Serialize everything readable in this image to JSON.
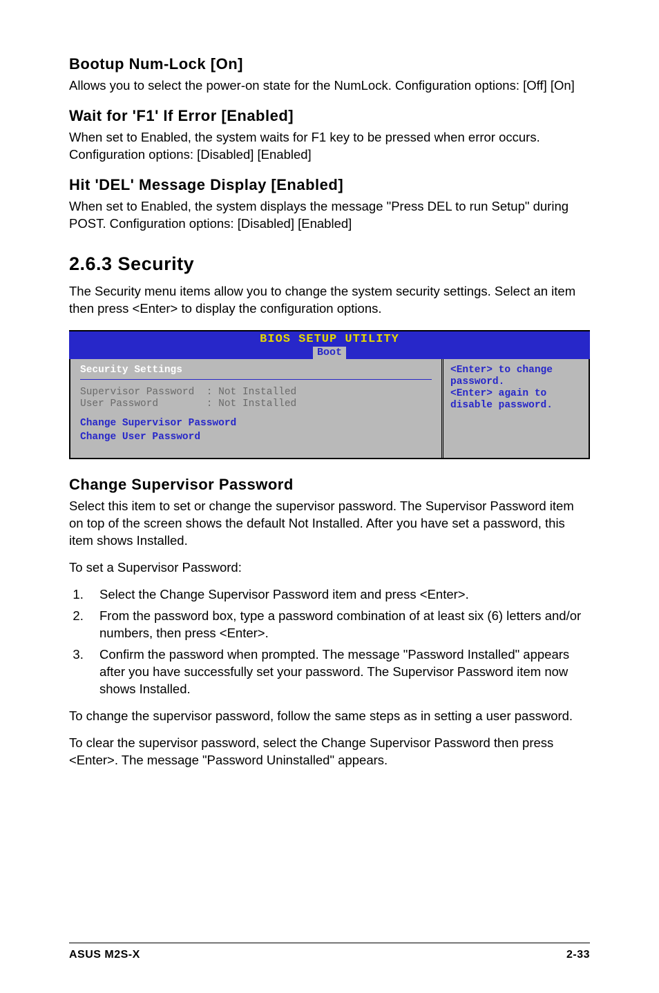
{
  "s1": {
    "h": "Bootup Num-Lock [On]",
    "p": "Allows you to select the power-on state for the NumLock. Configuration options: [Off] [On]"
  },
  "s2": {
    "h": "Wait for 'F1' If Error [Enabled]",
    "p": "When set to Enabled, the system waits for F1 key to be pressed when error occurs. Configuration options: [Disabled] [Enabled]"
  },
  "s3": {
    "h": "Hit 'DEL' Message Display [Enabled]",
    "p": "When set to Enabled, the system displays the message \"Press DEL to run Setup\" during POST. Configuration options: [Disabled] [Enabled]"
  },
  "sec": {
    "h": "2.6.3   Security",
    "p": "The Security menu items allow you to change the system security settings. Select an item then press <Enter> to display the configuration options."
  },
  "bios": {
    "title": "BIOS SETUP UTILITY",
    "tab": "Boot",
    "left_title": "Security Settings",
    "line1": "Supervisor Password  : Not Installed",
    "line2": "User Password        : Not Installed",
    "line3": "Change Supervisor Password",
    "line4": "Change User Password",
    "r1": "<Enter> to change",
    "r2": "password.",
    "r3": "<Enter> again to",
    "r4": "disable password."
  },
  "csp": {
    "h": "Change Supervisor Password",
    "p1": "Select this item to set or change the supervisor password. The Supervisor Password item on top of the screen shows the default Not Installed. After you have set a password, this item shows Installed.",
    "p2": "To set a Supervisor Password:",
    "li1": "Select the Change Supervisor Password item and press <Enter>.",
    "li2": "From the password box, type a password combination of at least six (6) letters and/or numbers, then press <Enter>.",
    "li3": "Confirm the password when prompted. The message \"Password Installed\" appears after you have successfully set your password. The Supervisor Password item now shows Installed.",
    "p3": "To change the supervisor password, follow the same steps as in setting a user password.",
    "p4": "To clear the supervisor password, select the Change Supervisor Password then press <Enter>. The message \"Password Uninstalled\" appears."
  },
  "footer": {
    "left": "ASUS M2S-X",
    "right": "2-33"
  }
}
